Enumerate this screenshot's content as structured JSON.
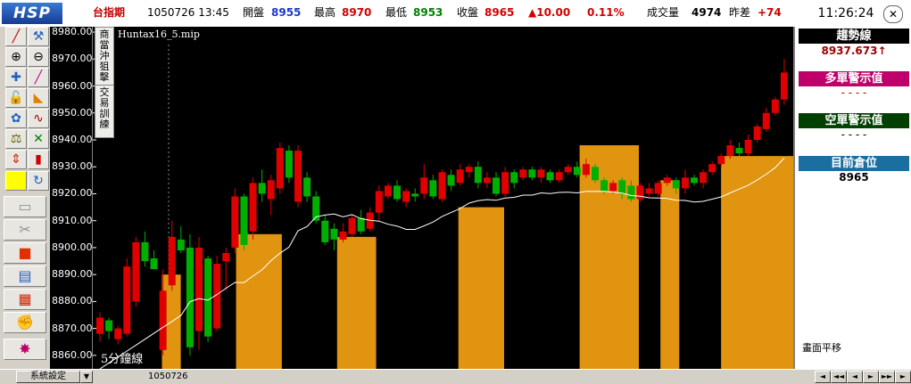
{
  "header": {
    "logo": "HSP",
    "index_name": "台指期",
    "date_time": "1050726  13:45",
    "open_label": "開盤",
    "open_value": "8955",
    "high_label": "最高",
    "high_value": "8970",
    "low_label": "最低",
    "low_value": "8953",
    "close_label": "收盤",
    "close_value": "8965",
    "change": "▲10.00",
    "change_pct": "0.11%",
    "volume_label": "成交量",
    "volume_value": "4974",
    "spread_label": "昨差",
    "spread_value": "+74",
    "clock": "11:26:24",
    "close_icon": "✕"
  },
  "toolbar": {
    "icons": [
      "trendline-icon",
      "split-icon",
      "zoom-in-icon",
      "zoom-out-icon",
      "crosshair-icon",
      "pen-icon",
      "lock-icon",
      "ruler-icon",
      "gauge-icon",
      "wave-icon",
      "scale-icon",
      "compare-icon",
      "updown-icon",
      "candle-icon",
      "color-swatch-icon",
      "refresh-icon",
      "folder-icon",
      "tools-icon",
      "stop-icon",
      "list-icon",
      "grid-icon",
      "gloves-icon",
      "burst-icon"
    ]
  },
  "chart": {
    "file_label": "Huntax16_5.mip",
    "period_label": "5分鐘線",
    "side_tab_top": [
      "商",
      "當",
      "沖",
      "狙",
      "擊"
    ],
    "side_tab_bottom": [
      "交",
      "易",
      "訓",
      "練"
    ],
    "y_labels": [
      "8980.00",
      "8970.00",
      "8960.00",
      "8950.00",
      "8940.00",
      "8930.00",
      "8920.00",
      "8910.00",
      "8900.00",
      "8890.00",
      "8880.00",
      "8870.00",
      "8860.00"
    ]
  },
  "chart_data": {
    "type": "candlestick",
    "ylim": [
      8855,
      8982
    ],
    "ticks": [
      8980,
      8970,
      8960,
      8950,
      8940,
      8930,
      8920,
      8910,
      8900,
      8890,
      8880,
      8870,
      8860
    ],
    "up_color": "#e00000",
    "down_color": "#00b000",
    "band_color": "#e09410",
    "candles": [
      {
        "o": 8868,
        "c": 8874,
        "h": 8876,
        "l": 8865
      },
      {
        "o": 8873,
        "c": 8869,
        "h": 8874,
        "l": 8866
      },
      {
        "o": 8866,
        "c": 8870,
        "h": 8871,
        "l": 8864
      },
      {
        "o": 8868,
        "c": 8893,
        "h": 8896,
        "l": 8867
      },
      {
        "o": 8880,
        "c": 8902,
        "h": 8904,
        "l": 8878
      },
      {
        "o": 8902,
        "c": 8895,
        "h": 8906,
        "l": 8893
      },
      {
        "o": 8896,
        "c": 8892,
        "h": 8899,
        "l": 8893
      },
      {
        "o": 8862,
        "c": 8884,
        "h": 8892,
        "l": 8860
      },
      {
        "o": 8886,
        "c": 8904,
        "h": 8910,
        "l": 8884
      },
      {
        "o": 8903,
        "c": 8899,
        "h": 8908,
        "l": 8898
      },
      {
        "o": 8900,
        "c": 8863,
        "h": 8905,
        "l": 8860
      },
      {
        "o": 8869,
        "c": 8900,
        "h": 8904,
        "l": 8862
      },
      {
        "o": 8896,
        "c": 8867,
        "h": 8897,
        "l": 8865
      },
      {
        "o": 8870,
        "c": 8894,
        "h": 8897,
        "l": 8869
      },
      {
        "o": 8895,
        "c": 8898,
        "h": 8900,
        "l": 8884
      },
      {
        "o": 8900,
        "c": 8919,
        "h": 8922,
        "l": 8898
      },
      {
        "o": 8919,
        "c": 8901,
        "h": 8920,
        "l": 8899
      },
      {
        "o": 8906,
        "c": 8924,
        "h": 8926,
        "l": 8903
      },
      {
        "o": 8924,
        "c": 8920,
        "h": 8929,
        "l": 8917
      },
      {
        "o": 8918,
        "c": 8925,
        "h": 8927,
        "l": 8912
      },
      {
        "o": 8922,
        "c": 8937,
        "h": 8939,
        "l": 8920
      },
      {
        "o": 8936,
        "c": 8926,
        "h": 8938,
        "l": 8924
      },
      {
        "o": 8917,
        "c": 8936,
        "h": 8938,
        "l": 8915
      },
      {
        "o": 8926,
        "c": 8919,
        "h": 8928,
        "l": 8917
      },
      {
        "o": 8919,
        "c": 8910,
        "h": 8921,
        "l": 8909
      },
      {
        "o": 8910,
        "c": 8902,
        "h": 8912,
        "l": 8901
      },
      {
        "o": 8907,
        "c": 8903,
        "h": 8909,
        "l": 8899
      },
      {
        "o": 8903,
        "c": 8906,
        "h": 8909,
        "l": 8902
      },
      {
        "o": 8905,
        "c": 8911,
        "h": 8912,
        "l": 8904
      },
      {
        "o": 8911,
        "c": 8906,
        "h": 8914,
        "l": 8905
      },
      {
        "o": 8907,
        "c": 8913,
        "h": 8915,
        "l": 8906
      },
      {
        "o": 8913,
        "c": 8921,
        "h": 8923,
        "l": 8910
      },
      {
        "o": 8919,
        "c": 8923,
        "h": 8924,
        "l": 8918
      },
      {
        "o": 8923,
        "c": 8918,
        "h": 8925,
        "l": 8917
      },
      {
        "o": 8917,
        "c": 8921,
        "h": 8922,
        "l": 8915
      },
      {
        "o": 8920,
        "c": 8919,
        "h": 8922,
        "l": 8917
      },
      {
        "o": 8920,
        "c": 8926,
        "h": 8931,
        "l": 8918
      },
      {
        "o": 8925,
        "c": 8919,
        "h": 8927,
        "l": 8918
      },
      {
        "o": 8918,
        "c": 8928,
        "h": 8929,
        "l": 8917
      },
      {
        "o": 8927,
        "c": 8923,
        "h": 8929,
        "l": 8921
      },
      {
        "o": 8924,
        "c": 8929,
        "h": 8931,
        "l": 8923
      },
      {
        "o": 8928,
        "c": 8930,
        "h": 8931,
        "l": 8926
      },
      {
        "o": 8930,
        "c": 8924,
        "h": 8932,
        "l": 8922
      },
      {
        "o": 8924,
        "c": 8926,
        "h": 8928,
        "l": 8922
      },
      {
        "o": 8926,
        "c": 8920,
        "h": 8928,
        "l": 8919
      },
      {
        "o": 8920,
        "c": 8928,
        "h": 8930,
        "l": 8919
      },
      {
        "o": 8928,
        "c": 8924,
        "h": 8929,
        "l": 8922
      },
      {
        "o": 8926,
        "c": 8929,
        "h": 8930,
        "l": 8925
      },
      {
        "o": 8929,
        "c": 8926,
        "h": 8930,
        "l": 8925
      },
      {
        "o": 8926,
        "c": 8929,
        "h": 8930,
        "l": 8924
      },
      {
        "o": 8928,
        "c": 8925,
        "h": 8929,
        "l": 8924
      },
      {
        "o": 8925,
        "c": 8928,
        "h": 8929,
        "l": 8924
      },
      {
        "o": 8928,
        "c": 8930,
        "h": 8931,
        "l": 8927
      },
      {
        "o": 8930,
        "c": 8927,
        "h": 8932,
        "l": 8926
      },
      {
        "o": 8927,
        "c": 8931,
        "h": 8933,
        "l": 8926
      },
      {
        "o": 8930,
        "c": 8925,
        "h": 8931,
        "l": 8924
      },
      {
        "o": 8925,
        "c": 8921,
        "h": 8926,
        "l": 8920
      },
      {
        "o": 8921,
        "c": 8924,
        "h": 8925,
        "l": 8920
      },
      {
        "o": 8925,
        "c": 8920,
        "h": 8926,
        "l": 8918
      },
      {
        "o": 8923,
        "c": 8918,
        "h": 8925,
        "l": 8917
      },
      {
        "o": 8918,
        "c": 8923,
        "h": 8924,
        "l": 8917
      },
      {
        "o": 8920,
        "c": 8922,
        "h": 8924,
        "l": 8919
      },
      {
        "o": 8920,
        "c": 8924,
        "h": 8925,
        "l": 8919
      },
      {
        "o": 8924,
        "c": 8926,
        "h": 8927,
        "l": 8923
      },
      {
        "o": 8925,
        "c": 8922,
        "h": 8926,
        "l": 8920
      },
      {
        "o": 8922,
        "c": 8926,
        "h": 8929,
        "l": 8920
      },
      {
        "o": 8926,
        "c": 8924,
        "h": 8927,
        "l": 8923
      },
      {
        "o": 8924,
        "c": 8928,
        "h": 8929,
        "l": 8922
      },
      {
        "o": 8928,
        "c": 8931,
        "h": 8932,
        "l": 8927
      },
      {
        "o": 8931,
        "c": 8934,
        "h": 8935,
        "l": 8930
      },
      {
        "o": 8934,
        "c": 8938,
        "h": 8940,
        "l": 8933
      },
      {
        "o": 8937,
        "c": 8935,
        "h": 8939,
        "l": 8934
      },
      {
        "o": 8935,
        "c": 8940,
        "h": 8942,
        "l": 8934
      },
      {
        "o": 8940,
        "c": 8945,
        "h": 8946,
        "l": 8939
      },
      {
        "o": 8944,
        "c": 8950,
        "h": 8952,
        "l": 8943
      },
      {
        "o": 8950,
        "c": 8955,
        "h": 8956,
        "l": 8949
      },
      {
        "o": 8955,
        "c": 8965,
        "h": 8970,
        "l": 8953
      }
    ],
    "band_segments": [
      {
        "start": 10,
        "end": 12,
        "top": 8890
      },
      {
        "start": 21,
        "end": 27,
        "top": 8905
      },
      {
        "start": 36,
        "end": 41,
        "top": 8904
      },
      {
        "start": 54,
        "end": 60,
        "top": 8915
      },
      {
        "start": 72,
        "end": 80,
        "top": 8938
      },
      {
        "start": 84,
        "end": 86,
        "top": 8925
      },
      {
        "start": 93,
        "end": 104,
        "top": 8934
      }
    ]
  },
  "right_panel": {
    "trend_label": "趨勢線",
    "trend_value": "8937.673↑",
    "long_label": "多單警示值",
    "long_value": "- - - -",
    "short_label": "空單警示值",
    "short_value": "- - - -",
    "position_label": "目前倉位",
    "position_value": "8965",
    "status_text": "畫面平移",
    "colors": {
      "trend": "#000000",
      "long": "#c0006a",
      "short": "#004000",
      "position": "#1a6ea0"
    }
  },
  "bottom": {
    "settings_label": "系統設定",
    "dropdown_icon": "▼",
    "date_label": "1050726",
    "nav": [
      "◄",
      "◄◄",
      "◄",
      "►",
      "►►",
      "►"
    ]
  }
}
